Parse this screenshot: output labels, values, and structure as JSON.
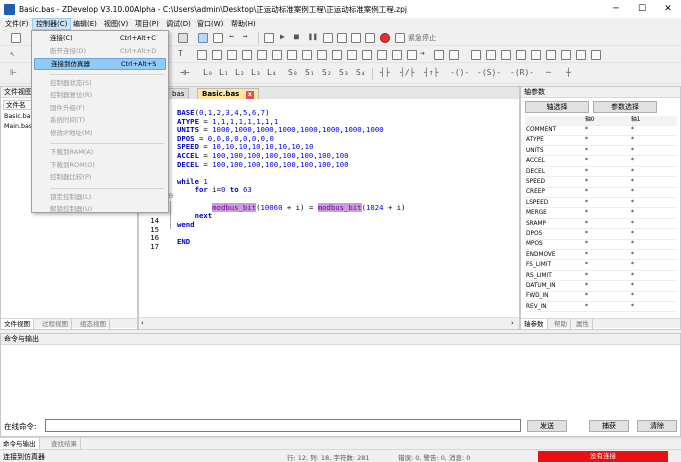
{
  "window": {
    "title": "Basic.bas - ZDevelop V3.10.00Alpha - C:\\Users\\admin\\Desktop\\正运动标准案例工程\\正运动标准案例工程.zpj",
    "minimize": "─",
    "maximize": "☐",
    "close": "✕"
  },
  "menubar": [
    "文件(F)",
    "控制器(C)",
    "编辑(E)",
    "视图(V)",
    "项目(P)",
    "调试(D)",
    "窗口(W)",
    "帮助(H)"
  ],
  "toolbar": {
    "emergency_stop": "紧急停止",
    "row3_labels": [
      "L₀",
      "L₁",
      "L₂",
      "L₃",
      "L₄",
      "S₀",
      "S₁",
      "S₂",
      "S₃",
      "S₄"
    ]
  },
  "dropdown": {
    "items": [
      {
        "label": "连接(C)",
        "shortcut": "Ctrl+Alt+C",
        "state": "normal"
      },
      {
        "label": "断开连接(D)",
        "shortcut": "Ctrl+Alt+D",
        "state": "disabled"
      },
      {
        "label": "连接到仿真器",
        "shortcut": "Ctrl+Alt+S",
        "state": "highlighted"
      },
      {
        "sep": true
      },
      {
        "label": "控制器状态(S)",
        "shortcut": "",
        "state": "disabled"
      },
      {
        "label": "控制器复位(R)",
        "shortcut": "",
        "state": "disabled"
      },
      {
        "label": "固件升级(F)",
        "shortcut": "",
        "state": "disabled"
      },
      {
        "label": "系统时间(T)",
        "shortcut": "",
        "state": "disabled"
      },
      {
        "label": "修改IP地址(M)",
        "shortcut": "",
        "state": "disabled"
      },
      {
        "sep": true
      },
      {
        "label": "下载到RAM(A)",
        "shortcut": "",
        "state": "disabled"
      },
      {
        "label": "下载到ROM(O)",
        "shortcut": "",
        "state": "disabled"
      },
      {
        "label": "控制器比较(P)",
        "shortcut": "",
        "state": "disabled"
      },
      {
        "sep": true
      },
      {
        "label": "锁定控制器(L)",
        "shortcut": "",
        "state": "disabled"
      },
      {
        "label": "解锁控制器(U)",
        "shortcut": "",
        "state": "disabled"
      }
    ]
  },
  "left_panel": {
    "header": "文件视图",
    "col_header": "文件名",
    "files": [
      "Basic.bas",
      "Main.bas"
    ],
    "tabs": [
      "文件视图",
      "过程视图",
      "组态视图"
    ]
  },
  "editor": {
    "tabs": [
      {
        "label": "bas",
        "active": false
      },
      {
        "label": "Basic.bas",
        "active": true
      }
    ],
    "tab_close": "x",
    "visible_line_numbers": [
      "14",
      "15",
      "16",
      "17"
    ],
    "lines": [
      "BASE(0,1,2,3,4,5,6,7)",
      "ATYPE = 1,1,1,1,1,1,1,1",
      "UNITS = 1000,1000,1000,1000,1000,1000,1000,1000",
      "DPOS = 0,0,0,0,0,0,0,0",
      "SPEED = 10,10,10,10,10,10,10,10",
      "ACCEL = 100,100,100,100,100,100,100,100",
      "DECEL = 100,100,100,100,100,100,100,100",
      "",
      "while 1",
      "    for i=0 to 63",
      "",
      "        modbus_bit(10060 + i) = modbus_bit(1024 + i)",
      "    next",
      "wend",
      "",
      "END"
    ]
  },
  "right_panel": {
    "header": "轴参数",
    "btn_axis": "轴选择",
    "btn_param": "参数选择",
    "col_headers": [
      "",
      "轴0",
      "轴1"
    ],
    "rows": [
      "COMMENT",
      "ATYPE",
      "UNITS",
      "ACCEL",
      "DECEL",
      "SPEED",
      "CREEP",
      "LSPEED",
      "MERGE",
      "SRAMP",
      "DPOS",
      "MPOS",
      "ENDMOVE",
      "FS_LIMIT",
      "RS_LIMIT",
      "DATUM_IN",
      "FWD_IN",
      "REV_IN"
    ],
    "cell_value": "*",
    "tabs": [
      "轴参数",
      "帮助",
      "属性"
    ]
  },
  "command_panel": {
    "header": "命令与输出",
    "input_label": "在线命令:",
    "send": "发送",
    "capture": "捕获",
    "clear": "清除",
    "tabs": [
      "命令与输出",
      "查找结果"
    ]
  },
  "statusbar": {
    "left": "连接到仿真器",
    "position": "行: 12, 列: 18, 字符数: 281",
    "errors": "错误: 0, 警告: 0, 消息: 0",
    "connection": "没有连接"
  },
  "colors": {
    "accent": "#91c9f7",
    "status_red": "#e81010",
    "keyword": "#0000c8"
  }
}
